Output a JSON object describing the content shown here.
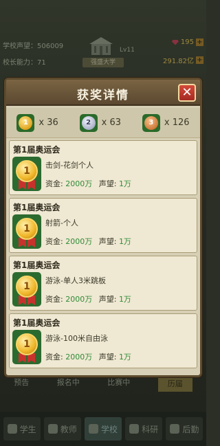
{
  "hud": {
    "school_reputation": "学校声望：506009",
    "principal_ability": "校长能力：71",
    "gems": "195",
    "gold": "291.82亿",
    "level": "Lv11",
    "school_name": "强盛大学"
  },
  "bottom_tabs": [
    "预告",
    "报名中",
    "比赛中",
    "历届"
  ],
  "nav": [
    "学生",
    "教师",
    "学校",
    "科研",
    "后勤"
  ],
  "dialog": {
    "title": "获奖详情",
    "close": "✕",
    "summary": [
      {
        "rank": "1",
        "count": "x 36"
      },
      {
        "rank": "2",
        "count": "x 63"
      },
      {
        "rank": "3",
        "count": "x 126"
      }
    ],
    "awards": [
      {
        "title": "第1届奥运会",
        "event": "击剑-花剑个人",
        "funds_label": "资金:",
        "funds": "2000万",
        "rep_label": "声望:",
        "rep": "1万"
      },
      {
        "title": "第1届奥运会",
        "event": "射箭-个人",
        "funds_label": "资金:",
        "funds": "2000万",
        "rep_label": "声望:",
        "rep": "1万"
      },
      {
        "title": "第1届奥运会",
        "event": "游泳-单人3米跳板",
        "funds_label": "资金:",
        "funds": "2000万",
        "rep_label": "声望:",
        "rep": "1万"
      },
      {
        "title": "第1届奥运会",
        "event": "游泳-100米自由泳",
        "funds_label": "资金:",
        "funds": "2000万",
        "rep_label": "声望:",
        "rep": "1万"
      }
    ]
  }
}
